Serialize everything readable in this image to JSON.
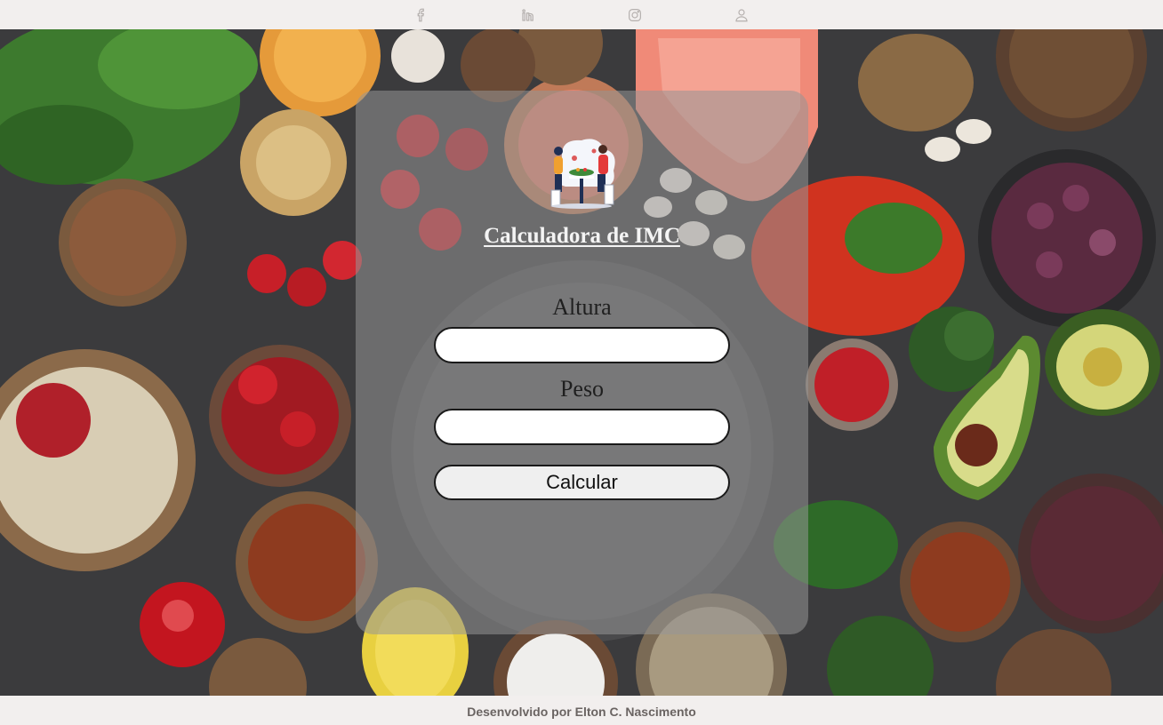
{
  "nav": {
    "icons": [
      "facebook-icon",
      "linkedin-icon",
      "instagram-icon",
      "user-icon"
    ]
  },
  "card": {
    "title": "Calculadora de IMC",
    "height_label": "Altura",
    "height_value": "",
    "weight_label": "Peso",
    "weight_value": "",
    "submit_label": "Calcular"
  },
  "footer": {
    "credit": "Desenvolvido por Elton C. Nascimento"
  },
  "colors": {
    "bar_background": "#f2efee",
    "footer_text": "#6a6462",
    "title_text": "#f4f4f4",
    "card_overlay": "rgba(150,150,150,0.55)"
  }
}
